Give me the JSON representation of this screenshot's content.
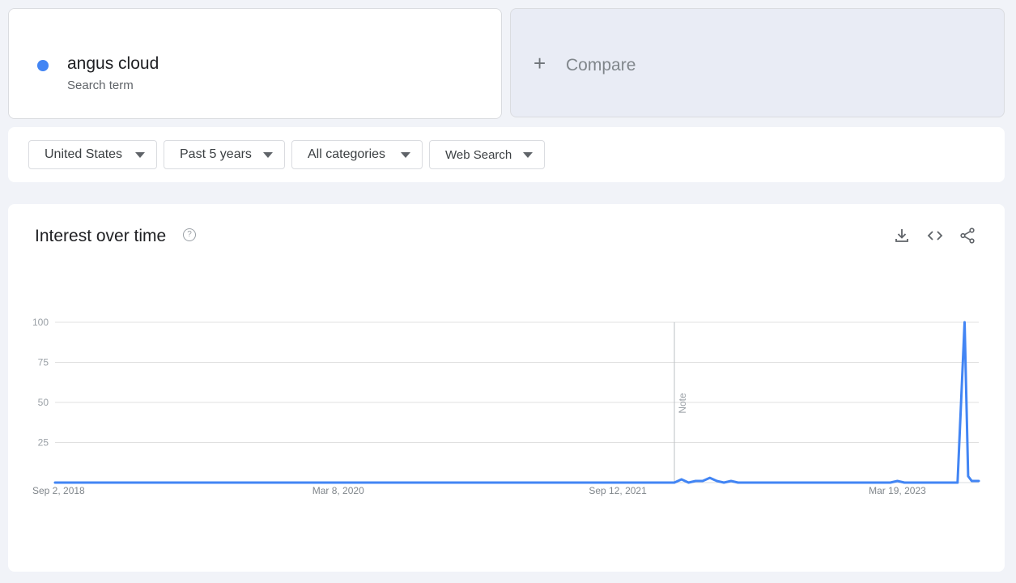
{
  "term": {
    "name": "angus cloud",
    "subtitle": "Search term",
    "color": "#4285f4"
  },
  "compare": {
    "plus_icon": "+",
    "label": "Compare"
  },
  "filters": [
    {
      "label": "United States"
    },
    {
      "label": "Past 5 years"
    },
    {
      "label": "All categories"
    },
    {
      "label": "Web Search"
    }
  ],
  "chart_card": {
    "title": "Interest over time",
    "help_icon": "?",
    "actions": [
      "download-icon",
      "embed-icon",
      "share-icon"
    ]
  },
  "chart_data": {
    "type": "line",
    "title": "",
    "xlabel": "",
    "ylabel": "",
    "ylim": [
      0,
      100
    ],
    "yticks": [
      25,
      50,
      75,
      100
    ],
    "x_range": [
      "2018-08-26",
      "2023-08-27"
    ],
    "xticks": [
      {
        "date": "2018-09-02",
        "label": "Sep 2, 2018"
      },
      {
        "date": "2020-03-08",
        "label": "Mar 8, 2020"
      },
      {
        "date": "2021-09-12",
        "label": "Sep 12, 2021"
      },
      {
        "date": "2023-03-19",
        "label": "Mar 19, 2023"
      }
    ],
    "note": {
      "date": "2022-01-02",
      "label": "Note"
    },
    "grid": true,
    "series": [
      {
        "color": "#4285f4",
        "x": [
          "2018-08-26",
          "2022-01-02",
          "2022-01-16",
          "2022-01-30",
          "2022-02-13",
          "2022-02-27",
          "2022-03-13",
          "2022-03-27",
          "2022-04-10",
          "2022-04-24",
          "2022-05-08",
          "2022-05-22",
          "2023-03-05",
          "2023-03-19",
          "2023-04-02",
          "2023-07-16",
          "2023-07-30",
          "2023-08-06",
          "2023-08-13",
          "2023-08-27"
        ],
        "y": [
          0,
          0,
          2,
          0,
          1,
          1,
          3,
          1,
          0,
          1,
          0,
          0,
          0,
          1,
          0,
          0,
          100,
          4,
          1,
          1
        ]
      }
    ]
  }
}
